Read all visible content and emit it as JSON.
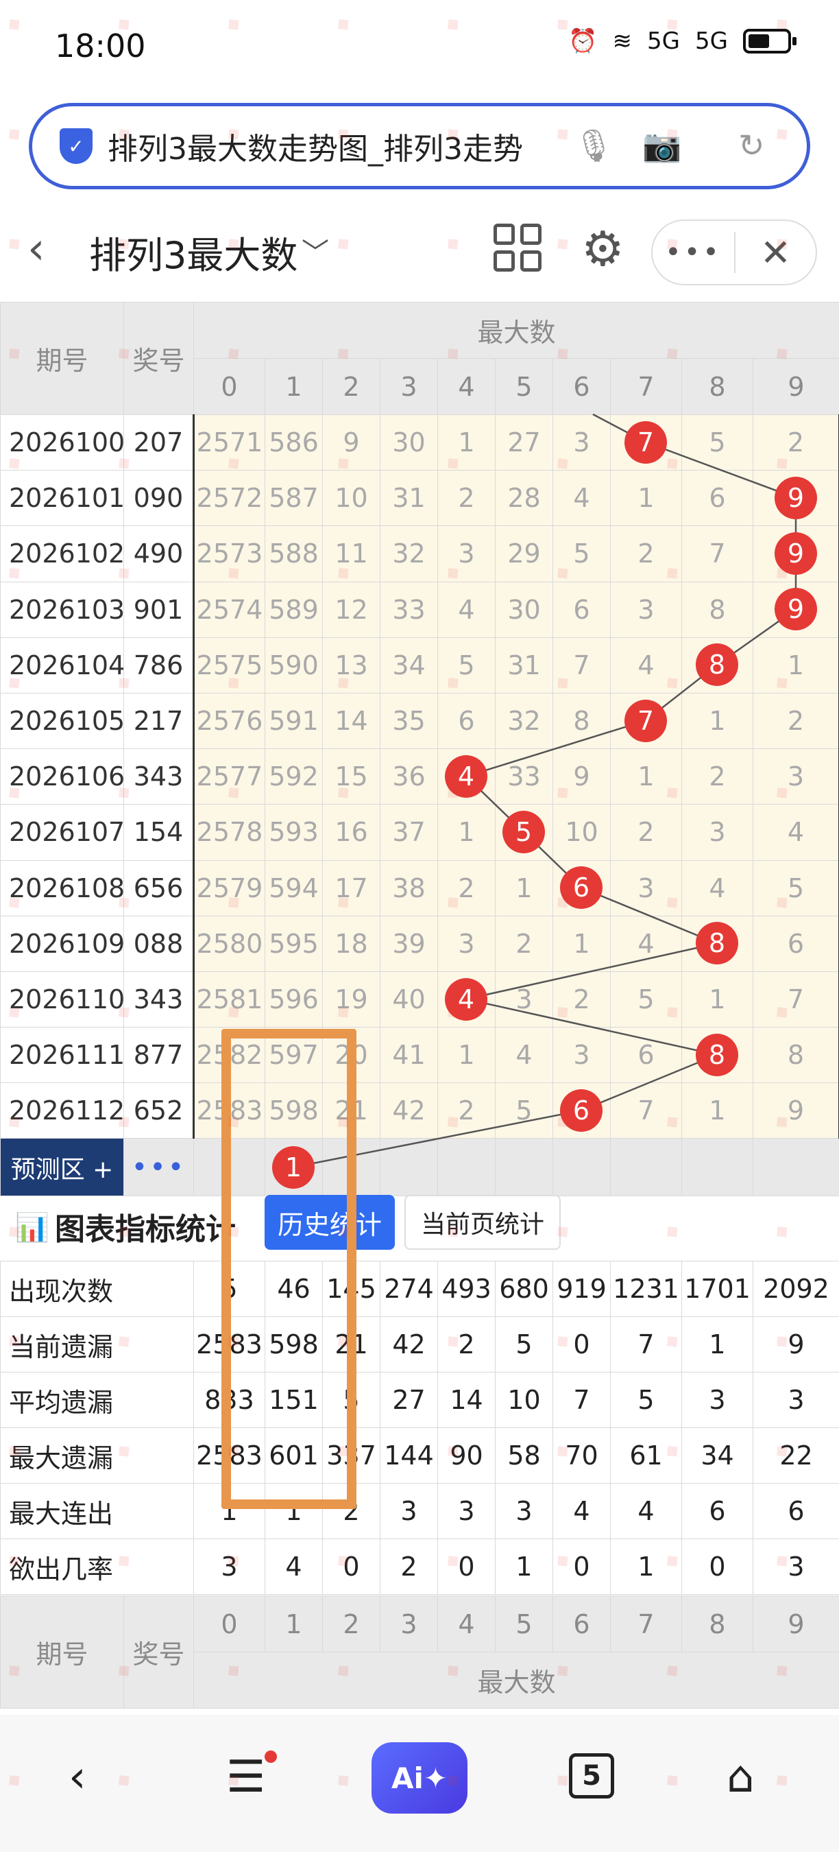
{
  "status_bar": {
    "time": "18:00",
    "signal_1": "5G",
    "signal_2": "5G"
  },
  "address_bar": {
    "url_text": "排列3最大数走势图_排列3走势"
  },
  "page_header": {
    "title": "排列3最大数",
    "caret": "﹀"
  },
  "table": {
    "head_period": "期号",
    "head_prize": "奖号",
    "head_group": "最大数",
    "digits": [
      "0",
      "1",
      "2",
      "3",
      "4",
      "5",
      "6",
      "7",
      "8",
      "9"
    ],
    "rows": [
      {
        "period": "2026100",
        "prize": "207",
        "cells": [
          "2571",
          "586",
          "9",
          "30",
          "1",
          "27",
          "3",
          "7",
          "5",
          "2"
        ],
        "hit": 7
      },
      {
        "period": "2026101",
        "prize": "090",
        "cells": [
          "2572",
          "587",
          "10",
          "31",
          "2",
          "28",
          "4",
          "1",
          "6",
          "9"
        ],
        "hit": 9
      },
      {
        "period": "2026102",
        "prize": "490",
        "cells": [
          "2573",
          "588",
          "11",
          "32",
          "3",
          "29",
          "5",
          "2",
          "7",
          "9"
        ],
        "hit": 9
      },
      {
        "period": "2026103",
        "prize": "901",
        "cells": [
          "2574",
          "589",
          "12",
          "33",
          "4",
          "30",
          "6",
          "3",
          "8",
          "9"
        ],
        "hit": 9
      },
      {
        "period": "2026104",
        "prize": "786",
        "cells": [
          "2575",
          "590",
          "13",
          "34",
          "5",
          "31",
          "7",
          "4",
          "8",
          "1"
        ],
        "hit": 8
      },
      {
        "period": "2026105",
        "prize": "217",
        "cells": [
          "2576",
          "591",
          "14",
          "35",
          "6",
          "32",
          "8",
          "7",
          "1",
          "2"
        ],
        "hit": 7
      },
      {
        "period": "2026106",
        "prize": "343",
        "cells": [
          "2577",
          "592",
          "15",
          "36",
          "4",
          "33",
          "9",
          "1",
          "2",
          "3"
        ],
        "hit": 4
      },
      {
        "period": "2026107",
        "prize": "154",
        "cells": [
          "2578",
          "593",
          "16",
          "37",
          "1",
          "5",
          "10",
          "2",
          "3",
          "4"
        ],
        "hit": 5
      },
      {
        "period": "2026108",
        "prize": "656",
        "cells": [
          "2579",
          "594",
          "17",
          "38",
          "2",
          "1",
          "6",
          "3",
          "4",
          "5"
        ],
        "hit": 6
      },
      {
        "period": "2026109",
        "prize": "088",
        "cells": [
          "2580",
          "595",
          "18",
          "39",
          "3",
          "2",
          "1",
          "4",
          "8",
          "6"
        ],
        "hit": 8
      },
      {
        "period": "2026110",
        "prize": "343",
        "cells": [
          "2581",
          "596",
          "19",
          "40",
          "4",
          "3",
          "2",
          "5",
          "1",
          "7"
        ],
        "hit": 4
      },
      {
        "period": "2026111",
        "prize": "877",
        "cells": [
          "2582",
          "597",
          "20",
          "41",
          "1",
          "4",
          "3",
          "6",
          "8",
          "8"
        ],
        "hit": 8
      },
      {
        "period": "2026112",
        "prize": "652",
        "cells": [
          "2583",
          "598",
          "21",
          "42",
          "2",
          "5",
          "6",
          "7",
          "1",
          "9"
        ],
        "hit": 6
      }
    ],
    "prediction": {
      "label": "预测区 +",
      "dots": "•••",
      "hit": 1,
      "hit_label": "1"
    }
  },
  "stats_section": {
    "title": "图表指标统计",
    "btn_history": "历史统计",
    "btn_current": "当前页统计",
    "rows": [
      {
        "label": "出现次数",
        "values": [
          "5",
          "46",
          "145",
          "274",
          "493",
          "680",
          "919",
          "1231",
          "1701",
          "2092"
        ]
      },
      {
        "label": "当前遗漏",
        "values": [
          "2583",
          "598",
          "21",
          "42",
          "2",
          "5",
          "0",
          "7",
          "1",
          "9"
        ]
      },
      {
        "label": "平均遗漏",
        "values": [
          "833",
          "151",
          "5",
          "27",
          "14",
          "10",
          "7",
          "5",
          "3",
          "3"
        ]
      },
      {
        "label": "最大遗漏",
        "values": [
          "2583",
          "601",
          "337",
          "144",
          "90",
          "58",
          "70",
          "61",
          "34",
          "22"
        ]
      },
      {
        "label": "最大连出",
        "values": [
          "1",
          "1",
          "2",
          "3",
          "3",
          "3",
          "4",
          "4",
          "6",
          "6"
        ]
      },
      {
        "label": "欲出几率",
        "values": [
          "3",
          "4",
          "0",
          "2",
          "0",
          "1",
          "0",
          "1",
          "0",
          "3"
        ]
      }
    ]
  },
  "bottom_nav": {
    "back": "‹",
    "menu": "☰",
    "ai": "Ai✦",
    "tabs": "5",
    "home": "⌂"
  },
  "colors": {
    "accent": "#2f6cf0",
    "ball": "#e53935",
    "highlight_box": "#e8964c",
    "pred_label_bg": "#1e3c74"
  }
}
